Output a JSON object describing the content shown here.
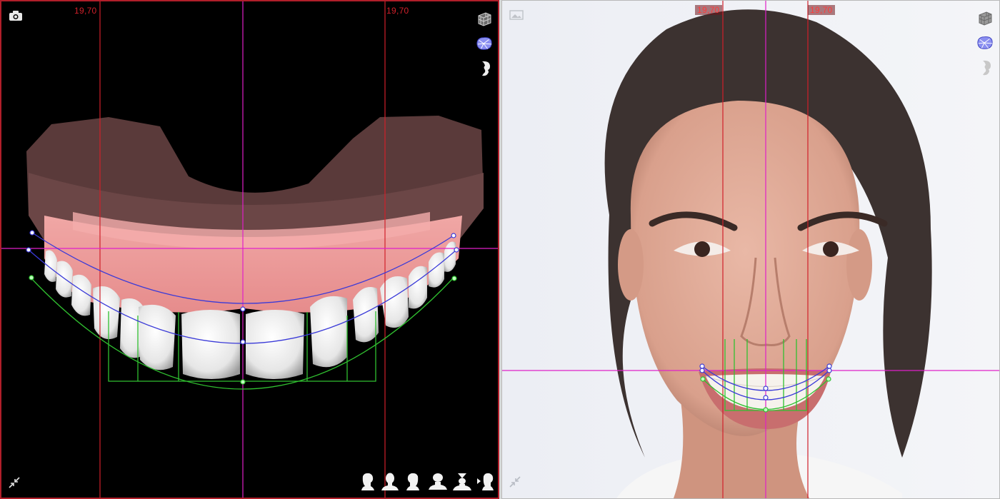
{
  "left_view": {
    "measure_left": "19,70",
    "measure_right": "19,70",
    "tools": {
      "snapshot": "camera-icon",
      "wireframe": "wireframe-cube-icon",
      "mesh": "mesh-shape-icon",
      "profile": "profile-silhouette-icon",
      "collapse": "collapse-arrows-icon"
    },
    "view_buttons": [
      "head-right-view-icon",
      "head-front-view-icon",
      "head-left-view-icon",
      "head-top-view-icon",
      "head-bottom-view-icon",
      "head-rotate-view-icon"
    ]
  },
  "right_view": {
    "measure_left": "19,70",
    "measure_right": "19,70",
    "tools": {
      "image": "image-icon",
      "wireframe": "wireframe-cube-icon",
      "mesh": "mesh-shape-icon",
      "profile": "profile-silhouette-icon",
      "expand": "expand-arrows-icon"
    }
  },
  "colors": {
    "guide_red": "#d0202a",
    "midline_magenta": "#e020c8",
    "curve_blue": "#3a3ad8",
    "curve_green": "#30c030",
    "frame_red": "#b01e2a"
  }
}
